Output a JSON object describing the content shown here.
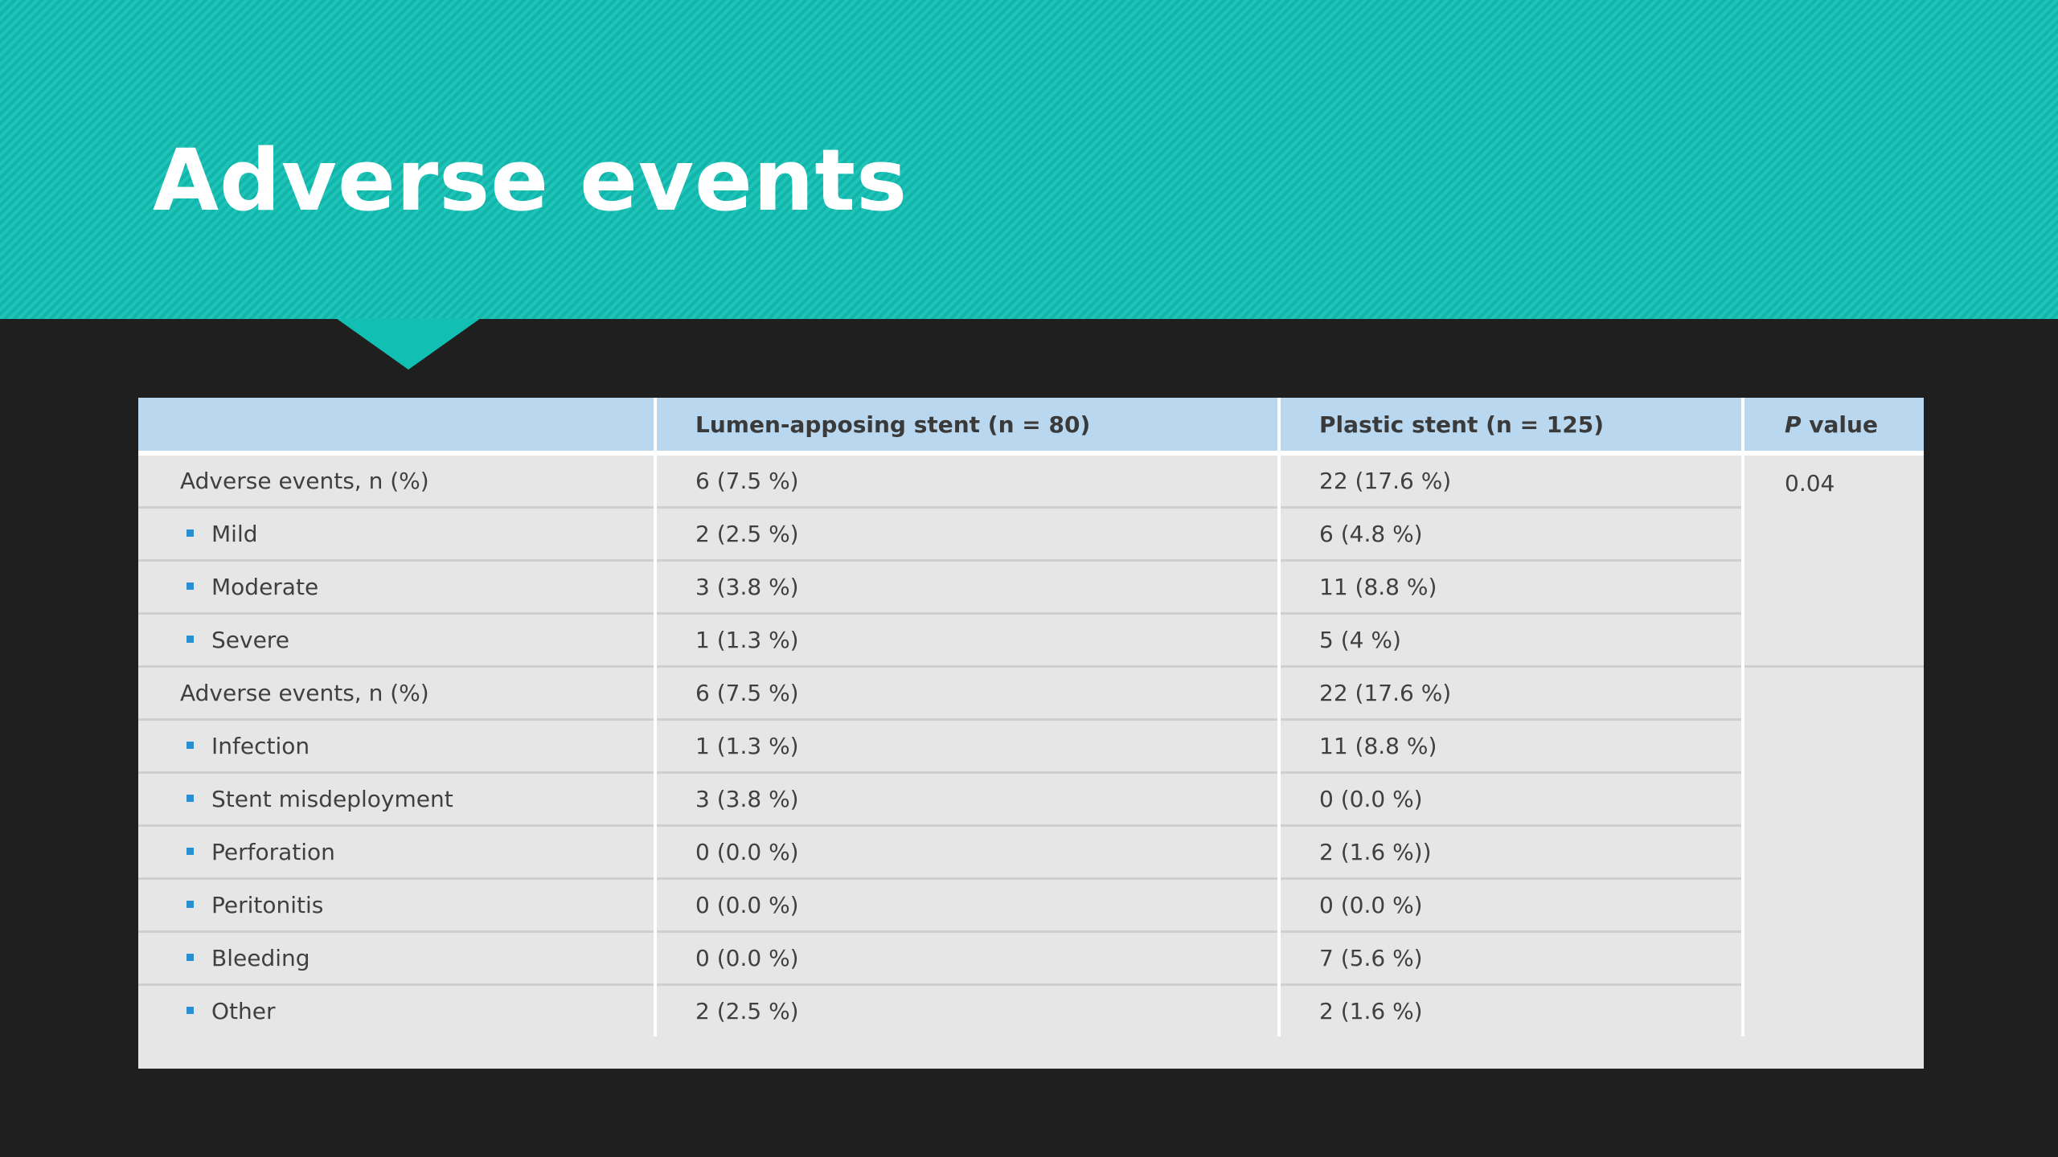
{
  "slide": {
    "title": "Adverse events",
    "colors": {
      "banner": "#12bfb3",
      "background": "#1f1f1f",
      "header_row": "#b9d8ef",
      "table_body": "#e6e6e6",
      "bullet": "#2a8fd0"
    }
  },
  "table": {
    "headers": [
      "",
      "Lumen-apposing stent (n = 80)",
      "Plastic stent (n = 125)",
      "P value"
    ],
    "header_p_italic": "P",
    "header_p_rest": " value",
    "p_value": "0.04",
    "groups": [
      {
        "label": "Adverse events, n (%)",
        "lams": "6 (7.5 %)",
        "plastic": "22 (17.6 %)",
        "rows": [
          {
            "label": "Mild",
            "lams": "2 (2.5 %)",
            "plastic": "6 (4.8 %)"
          },
          {
            "label": "Moderate",
            "lams": "3 (3.8 %)",
            "plastic": "11 (8.8 %)"
          },
          {
            "label": "Severe",
            "lams": "1 (1.3 %)",
            "plastic": "5 (4 %)"
          }
        ]
      },
      {
        "label": "Adverse events, n (%)",
        "lams": "6 (7.5 %)",
        "plastic": "22 (17.6 %)",
        "rows": [
          {
            "label": "Infection",
            "lams": "1 (1.3 %)",
            "plastic": "11 (8.8 %)"
          },
          {
            "label": "Stent misdeployment",
            "lams": "3 (3.8 %)",
            "plastic": "0 (0.0 %)"
          },
          {
            "label": "Perforation",
            "lams": "0 (0.0 %)",
            "plastic": "2 (1.6 %))"
          },
          {
            "label": "Peritonitis",
            "lams": "0 (0.0 %)",
            "plastic": "0 (0.0 %)"
          },
          {
            "label": "Bleeding",
            "lams": "0 (0.0 %)",
            "plastic": "7 (5.6 %)"
          },
          {
            "label": "Other",
            "lams": "2 (2.5 %)",
            "plastic": "2 (1.6 %)"
          }
        ]
      }
    ]
  }
}
